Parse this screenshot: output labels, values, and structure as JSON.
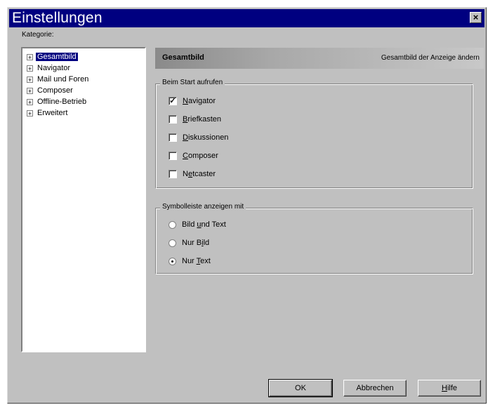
{
  "window": {
    "title": "Einstellungen",
    "close_glyph": "×"
  },
  "category_label": "Kategorie:",
  "tree": {
    "items": [
      {
        "label": "Gesamtbild",
        "expander": "+",
        "selected": true
      },
      {
        "label": "Navigator",
        "expander": "+",
        "selected": false
      },
      {
        "label": "Mail und Foren",
        "expander": "+",
        "selected": false
      },
      {
        "label": "Composer",
        "expander": "+",
        "selected": false
      },
      {
        "label": "Offline-Betrieb",
        "expander": "+",
        "selected": false
      },
      {
        "label": "Erweitert",
        "expander": "+",
        "selected": false
      }
    ]
  },
  "header": {
    "title": "Gesamtbild",
    "description": "Gesamtbild der Anzeige ändern"
  },
  "startup_group": {
    "legend": "Beim Start aufrufen",
    "options": [
      {
        "pre": "",
        "accel": "N",
        "post": "avigator",
        "checked": true
      },
      {
        "pre": "",
        "accel": "B",
        "post": "riefkasten",
        "checked": false
      },
      {
        "pre": "",
        "accel": "D",
        "post": "iskussionen",
        "checked": false
      },
      {
        "pre": "",
        "accel": "C",
        "post": "omposer",
        "checked": false
      },
      {
        "pre": "N",
        "accel": "e",
        "post": "tcaster",
        "checked": false
      }
    ]
  },
  "toolbar_group": {
    "legend": "Symbolleiste anzeigen mit",
    "options": [
      {
        "pre": "Bild ",
        "accel": "u",
        "post": "nd Text",
        "selected": false
      },
      {
        "pre": "Nur B",
        "accel": "i",
        "post": "ld",
        "selected": false
      },
      {
        "pre": "Nur ",
        "accel": "T",
        "post": "ext",
        "selected": true
      }
    ]
  },
  "buttons": {
    "ok": "OK",
    "cancel": "Abbrechen",
    "help_accel": "H",
    "help_rest": "ilfe"
  }
}
